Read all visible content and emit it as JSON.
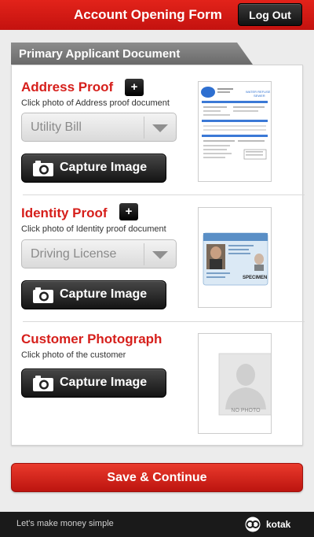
{
  "header": {
    "title": "Account Opening Form",
    "logout_label": "Log Out"
  },
  "section": {
    "title": "Primary Applicant Document"
  },
  "address_proof": {
    "title": "Address Proof",
    "add_label": "+",
    "subtitle": "Click photo of Address proof document",
    "selected": "Utility Bill",
    "capture_label": "Capture Image"
  },
  "identity_proof": {
    "title": "Identity Proof",
    "add_label": "+",
    "subtitle": "Click photo of Identity proof document",
    "selected": "Driving License",
    "capture_label": "Capture Image",
    "specimen_text": "SPECIMEN"
  },
  "customer_photo": {
    "title": "Customer Photograph",
    "subtitle": "Click photo of the customer",
    "capture_label": "Capture Image",
    "no_photo_text": "NO PHOTO"
  },
  "bill_thumb": {
    "heading_left": "WATER REFUSE",
    "heading_right": "SEWER"
  },
  "save_label": "Save & Continue",
  "footer": {
    "tagline": "Let's make money simple",
    "brand": "kotak"
  },
  "colors": {
    "accent": "#d61f1b",
    "header_bg": "#c4120f",
    "dark_button": "#1a1a1a"
  },
  "icons": [
    "camera-icon",
    "plus-icon",
    "dropdown-arrow-icon",
    "kotak-logo-icon"
  ]
}
